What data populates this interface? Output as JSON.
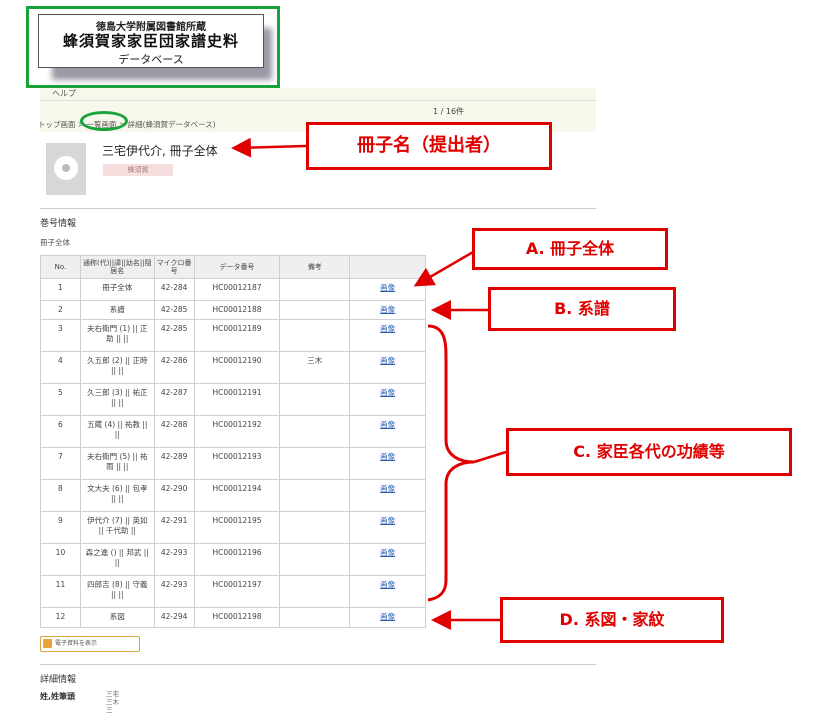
{
  "banner": {
    "line1": "徳島大学附属図書館所蔵",
    "line2": "蜂須賀家家臣団家譜史料",
    "line3": "データベース"
  },
  "nav": {
    "help": "ヘルプ",
    "page_count": "1 / 16件",
    "breadcrumb": {
      "top": "トップ画面",
      "sep1": " > ",
      "list": "一覧画面",
      "sep2": " > ",
      "detail": "詳細(蜂須賀データベース)"
    }
  },
  "record": {
    "title": "三宅伊代介, 冊子全体",
    "tag": "蜂須賀"
  },
  "volume_section": {
    "heading": "巻号情報",
    "subheading": "冊子全体",
    "columns": {
      "no": "No.",
      "name": "通称(代)||諱||幼名||隠居名",
      "micro": "マイクロ番号",
      "data_no": "データ番号",
      "note": "備考",
      "image": ""
    },
    "rows": [
      {
        "no": "1",
        "name": "冊子全体",
        "micro": "42-284",
        "data_no": "HC00012187",
        "note": "",
        "image": "画像"
      },
      {
        "no": "2",
        "name": "系譜",
        "micro": "42-285",
        "data_no": "HC00012188",
        "note": "",
        "image": "画像"
      },
      {
        "no": "3",
        "name": "夫右衛門 (1) || 正助 || ||",
        "micro": "42-285",
        "data_no": "HC00012189",
        "note": "",
        "image": "画像"
      },
      {
        "no": "4",
        "name": "久五郎 (2) || 正時 || ||",
        "micro": "42-286",
        "data_no": "HC00012190",
        "note": "三木",
        "image": "画像"
      },
      {
        "no": "5",
        "name": "久三郎 (3) || 祐正 || ||",
        "micro": "42-287",
        "data_no": "HC00012191",
        "note": "",
        "image": "画像"
      },
      {
        "no": "6",
        "name": "五蔵 (4) || 祐教 || ||",
        "micro": "42-288",
        "data_no": "HC00012192",
        "note": "",
        "image": "画像"
      },
      {
        "no": "7",
        "name": "夫右衛門 (5) || 祐雨 || ||",
        "micro": "42-289",
        "data_no": "HC00012193",
        "note": "",
        "image": "画像"
      },
      {
        "no": "8",
        "name": "文大夫 (6) || 包孝 || ||",
        "micro": "42-290",
        "data_no": "HC00012194",
        "note": "",
        "image": "画像"
      },
      {
        "no": "9",
        "name": "伊代介 (7) || 英如 || 千代助 ||",
        "micro": "42-291",
        "data_no": "HC00012195",
        "note": "",
        "image": "画像"
      },
      {
        "no": "10",
        "name": "森之進 () || 邦武 || ||",
        "micro": "42-293",
        "data_no": "HC00012196",
        "note": "",
        "image": "画像"
      },
      {
        "no": "11",
        "name": "四郎吉 (8) || 守義 || ||",
        "micro": "42-293",
        "data_no": "HC00012197",
        "note": "",
        "image": "画像"
      },
      {
        "no": "12",
        "name": "系図",
        "micro": "42-294",
        "data_no": "HC00012198",
        "note": "",
        "image": "画像"
      }
    ],
    "view_button": "電子資料を表示"
  },
  "detail_section": {
    "heading": "詳細情報",
    "label": "姓,姓筆頭",
    "values": [
      "三宅",
      "三木",
      "三"
    ]
  },
  "annotations": {
    "title_callout": "冊子名（提出者）",
    "a": "A. 冊子全体",
    "b": "B. 系譜",
    "c": "C. 家臣各代の功績等",
    "d": "D. 系図・家紋"
  },
  "colors": {
    "highlight_green": "#1aa33a",
    "annotation_red": "#e00000",
    "link_blue": "#2a5db0",
    "tag_pink": "#f7dede"
  }
}
